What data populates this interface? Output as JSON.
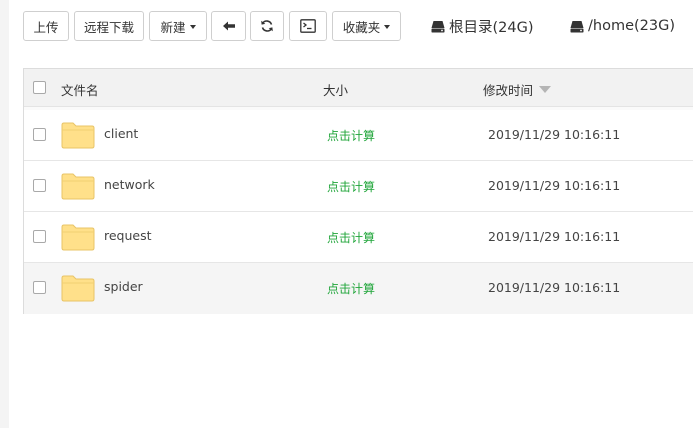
{
  "toolbar": {
    "upload_label": "上传",
    "remote_download_label": "远程下载",
    "new_label": "新建",
    "favorites_label": "收藏夹",
    "back_icon": "arrow-left-icon",
    "refresh_icon": "refresh-icon",
    "terminal_icon": "terminal-icon"
  },
  "disks": [
    {
      "label": "根目录(24G)",
      "icon": "hard-drive-icon"
    },
    {
      "label": "/home(23G)",
      "icon": "hard-drive-icon"
    }
  ],
  "table": {
    "headers": {
      "name": "文件名",
      "size": "大小",
      "mtime": "修改时间"
    },
    "sort_column": "mtime",
    "rows": [
      {
        "name": "client",
        "size": "点击计算",
        "mtime": "2019/11/29 10:16:11"
      },
      {
        "name": "network",
        "size": "点击计算",
        "mtime": "2019/11/29 10:16:11"
      },
      {
        "name": "request",
        "size": "点击计算",
        "mtime": "2019/11/29 10:16:11"
      },
      {
        "name": "spider",
        "size": "点击计算",
        "mtime": "2019/11/29 10:16:11"
      }
    ]
  },
  "colors": {
    "link_green": "#20a53a",
    "folder_fill": "#ffe08a",
    "folder_stroke": "#e8c467"
  }
}
